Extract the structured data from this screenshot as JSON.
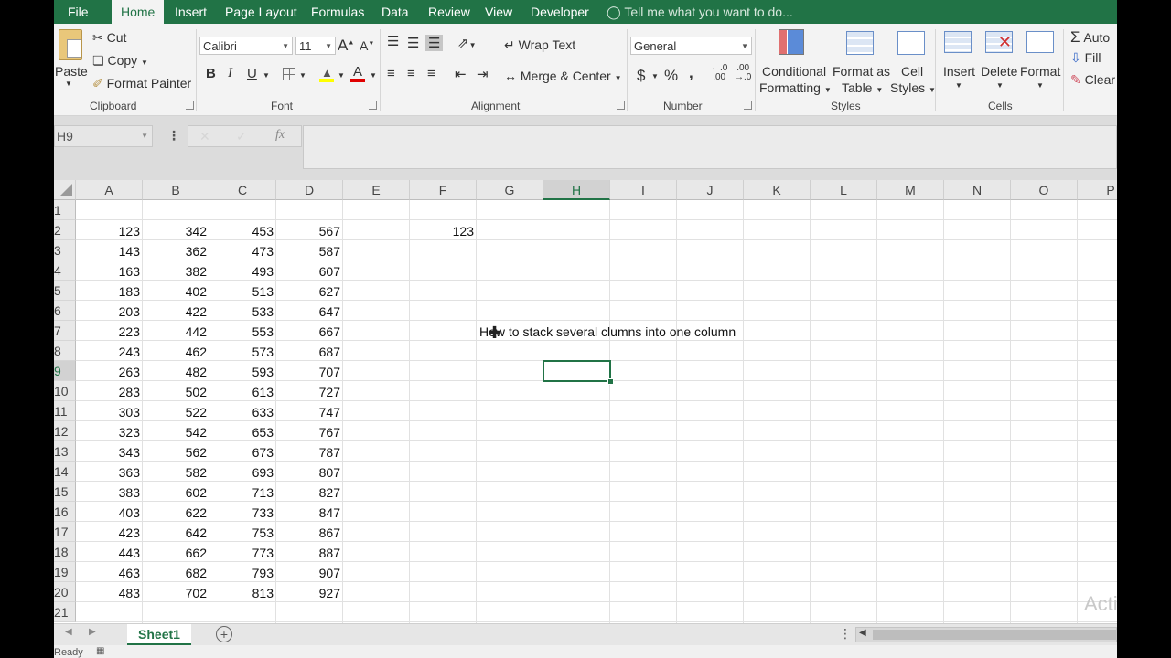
{
  "menu": {
    "tabs": [
      "File",
      "Home",
      "Insert",
      "Page Layout",
      "Formulas",
      "Data",
      "Review",
      "View",
      "Developer"
    ],
    "tell_me": "Tell me what you want to do..."
  },
  "ribbon": {
    "clipboard": {
      "paste": "Paste",
      "cut": "Cut",
      "copy": "Copy",
      "format_painter": "Format Painter",
      "label": "Clipboard"
    },
    "font": {
      "name": "Calibri",
      "size": "11",
      "label": "Font",
      "bold": "B",
      "italic": "I",
      "underline": "U"
    },
    "alignment": {
      "wrap_text": "Wrap Text",
      "merge_center": "Merge & Center",
      "label": "Alignment"
    },
    "number": {
      "format": "General",
      "currency": "$",
      "percent": "%",
      "comma": ",",
      "label": "Number"
    },
    "styles": {
      "conditional_formatting_line1": "Conditional",
      "conditional_formatting_line2": "Formatting",
      "format_as_table_line1": "Format as",
      "format_as_table_line2": "Table",
      "cell_styles_line1": "Cell",
      "cell_styles_line2": "Styles",
      "label": "Styles"
    },
    "cells": {
      "insert": "Insert",
      "delete": "Delete",
      "format": "Format",
      "label": "Cells"
    },
    "editing": {
      "autosum": "Auto",
      "fill": "Fill",
      "clear": "Clear"
    }
  },
  "formula_bar": {
    "name_box": "H9",
    "fx": "fx",
    "value": ""
  },
  "sheet": {
    "columns": [
      "A",
      "B",
      "C",
      "D",
      "E",
      "F",
      "G",
      "H",
      "I",
      "J",
      "K",
      "L",
      "M",
      "N",
      "O",
      "P"
    ],
    "selected_column": "H",
    "rows": [
      "1",
      "2",
      "3",
      "4",
      "5",
      "6",
      "7",
      "8",
      "9",
      "10",
      "11",
      "12",
      "13",
      "14",
      "15",
      "16",
      "17",
      "18",
      "19",
      "20",
      "21"
    ],
    "selected_row": "9",
    "data": [
      [
        "123",
        "342",
        "453",
        "567"
      ],
      [
        "143",
        "362",
        "473",
        "587"
      ],
      [
        "163",
        "382",
        "493",
        "607"
      ],
      [
        "183",
        "402",
        "513",
        "627"
      ],
      [
        "203",
        "422",
        "533",
        "647"
      ],
      [
        "223",
        "442",
        "553",
        "667"
      ],
      [
        "243",
        "462",
        "573",
        "687"
      ],
      [
        "263",
        "482",
        "593",
        "707"
      ],
      [
        "283",
        "502",
        "613",
        "727"
      ],
      [
        "303",
        "522",
        "633",
        "747"
      ],
      [
        "323",
        "542",
        "653",
        "767"
      ],
      [
        "343",
        "562",
        "673",
        "787"
      ],
      [
        "363",
        "582",
        "693",
        "807"
      ],
      [
        "383",
        "602",
        "713",
        "827"
      ],
      [
        "403",
        "622",
        "733",
        "847"
      ],
      [
        "423",
        "642",
        "753",
        "867"
      ],
      [
        "443",
        "662",
        "773",
        "887"
      ],
      [
        "463",
        "682",
        "793",
        "907"
      ],
      [
        "483",
        "702",
        "813",
        "927"
      ]
    ],
    "f2_value": "123",
    "g7_text": "How to stack several clumns into one column",
    "active_cell": "H9"
  },
  "sheet_tabs": {
    "active": "Sheet1",
    "add": "+"
  },
  "status": {
    "text": "Ready"
  },
  "watermark": "Acti",
  "colors": {
    "excel_green": "#217346",
    "ribbon_bg": "#f3f3f3"
  }
}
